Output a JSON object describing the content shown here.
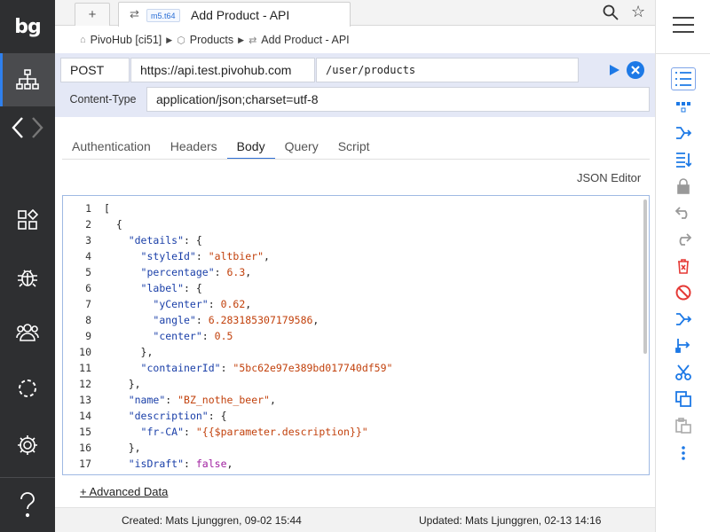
{
  "app": {
    "logo": "bg"
  },
  "tabs": {
    "new_label": "+",
    "active": {
      "badge": "m5.t64",
      "title": "Add Product - API"
    }
  },
  "breadcrumb": {
    "items": [
      "PivoHub [ci51]",
      "Products",
      "Add Product - API"
    ]
  },
  "request": {
    "method": "POST",
    "host": "https://api.test.pivohub.com",
    "path": "/user/products",
    "content_type_label": "Content-Type",
    "content_type_value": "application/json;charset=utf-8"
  },
  "subtabs": [
    "Authentication",
    "Headers",
    "Body",
    "Query",
    "Script"
  ],
  "active_subtab": "Body",
  "editor": {
    "mode_label": "JSON Editor",
    "line_numbers": [
      "1",
      "2",
      "3",
      "4",
      "5",
      "6",
      "7",
      "8",
      "9",
      "10",
      "11",
      "12",
      "13",
      "14",
      "15",
      "16",
      "17"
    ]
  },
  "advanced_link": "+ Advanced Data",
  "footer": {
    "created": "Created: Mats Ljunggren, 09-02 15:44",
    "updated": "Updated: Mats Ljunggren, 02-13 14:16"
  },
  "colors": {
    "accent": "#1d79e6",
    "nav_bg": "#2e2f31",
    "request_bg": "#e4e8f6",
    "danger": "#e53935"
  }
}
